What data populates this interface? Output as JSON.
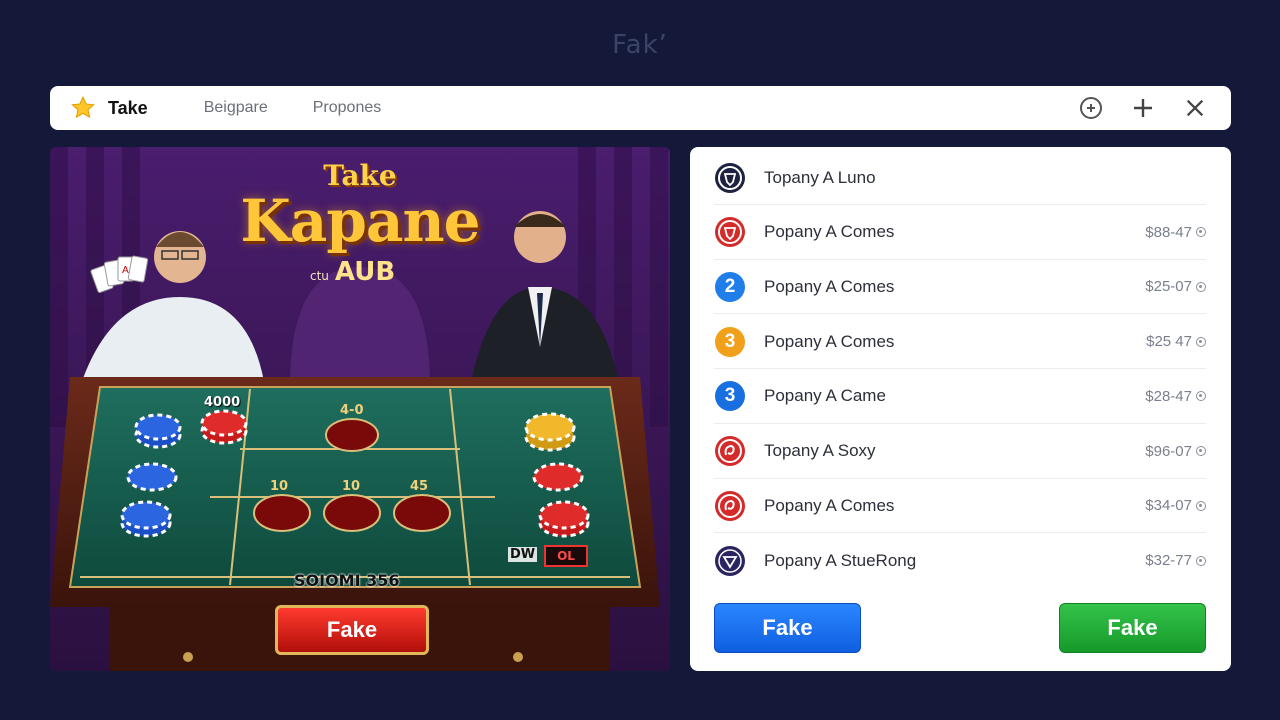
{
  "page": {
    "title": "Fak’"
  },
  "topbar": {
    "brand": "Take",
    "tabs": [
      "Beigpare",
      "Propones"
    ],
    "icons": {
      "logo": "star-icon",
      "actions": [
        "circle-plus-icon",
        "plus-icon",
        "close-icon"
      ]
    }
  },
  "game": {
    "title_small": "Take",
    "title_big": "Kapane",
    "sub_prefix": "ctu",
    "sub": "AUB",
    "labels": {
      "chips": "4000",
      "top_spot": "4-0",
      "spot_1": "10",
      "spot_2": "10",
      "spot_3": "45",
      "caption": "SOIOMI 356",
      "dw": "DW",
      "ol": "OL"
    },
    "button": "Fake"
  },
  "list": {
    "items": [
      {
        "label": "Topany A Luno",
        "amount": "",
        "icon": "shield-icon",
        "color": "#1c2240",
        "glyph": ""
      },
      {
        "label": "Popany A Comes",
        "amount": "$88-47",
        "icon": "shield-icon",
        "color": "#d42a2a",
        "glyph": ""
      },
      {
        "label": "Popany A Comes",
        "amount": "$25-07",
        "icon": "number-badge",
        "color": "#1f7ee8",
        "glyph": "2"
      },
      {
        "label": "Popany A Comes",
        "amount": "$25 47",
        "icon": "number-badge",
        "color": "#f0a01a",
        "glyph": "3"
      },
      {
        "label": "Popany A Came",
        "amount": "$28-47",
        "icon": "number-badge",
        "color": "#1a6fe0",
        "glyph": "3"
      },
      {
        "label": "Topany A Soxy",
        "amount": "$96-07",
        "icon": "swirl-icon",
        "color": "#d42a2a",
        "glyph": ""
      },
      {
        "label": "Popany A Comes",
        "amount": "$34-07",
        "icon": "swirl-icon",
        "color": "#d42a2a",
        "glyph": ""
      },
      {
        "label": "Popany A StueRong",
        "amount": "$32-77",
        "icon": "star-emblem-icon",
        "color": "#2a2560",
        "glyph": ""
      }
    ],
    "buttons": {
      "blue": "Fake",
      "green": "Fake"
    }
  }
}
